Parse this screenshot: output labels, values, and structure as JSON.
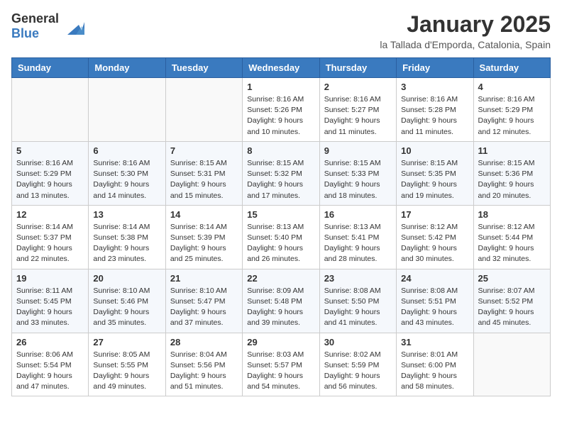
{
  "header": {
    "logo_general": "General",
    "logo_blue": "Blue",
    "month_title": "January 2025",
    "location": "la Tallada d'Emporda, Catalonia, Spain"
  },
  "weekdays": [
    "Sunday",
    "Monday",
    "Tuesday",
    "Wednesday",
    "Thursday",
    "Friday",
    "Saturday"
  ],
  "weeks": [
    [
      {
        "day": "",
        "sunrise": "",
        "sunset": "",
        "daylight": ""
      },
      {
        "day": "",
        "sunrise": "",
        "sunset": "",
        "daylight": ""
      },
      {
        "day": "",
        "sunrise": "",
        "sunset": "",
        "daylight": ""
      },
      {
        "day": "1",
        "sunrise": "Sunrise: 8:16 AM",
        "sunset": "Sunset: 5:26 PM",
        "daylight": "Daylight: 9 hours and 10 minutes."
      },
      {
        "day": "2",
        "sunrise": "Sunrise: 8:16 AM",
        "sunset": "Sunset: 5:27 PM",
        "daylight": "Daylight: 9 hours and 11 minutes."
      },
      {
        "day": "3",
        "sunrise": "Sunrise: 8:16 AM",
        "sunset": "Sunset: 5:28 PM",
        "daylight": "Daylight: 9 hours and 11 minutes."
      },
      {
        "day": "4",
        "sunrise": "Sunrise: 8:16 AM",
        "sunset": "Sunset: 5:29 PM",
        "daylight": "Daylight: 9 hours and 12 minutes."
      }
    ],
    [
      {
        "day": "5",
        "sunrise": "Sunrise: 8:16 AM",
        "sunset": "Sunset: 5:29 PM",
        "daylight": "Daylight: 9 hours and 13 minutes."
      },
      {
        "day": "6",
        "sunrise": "Sunrise: 8:16 AM",
        "sunset": "Sunset: 5:30 PM",
        "daylight": "Daylight: 9 hours and 14 minutes."
      },
      {
        "day": "7",
        "sunrise": "Sunrise: 8:15 AM",
        "sunset": "Sunset: 5:31 PM",
        "daylight": "Daylight: 9 hours and 15 minutes."
      },
      {
        "day": "8",
        "sunrise": "Sunrise: 8:15 AM",
        "sunset": "Sunset: 5:32 PM",
        "daylight": "Daylight: 9 hours and 17 minutes."
      },
      {
        "day": "9",
        "sunrise": "Sunrise: 8:15 AM",
        "sunset": "Sunset: 5:33 PM",
        "daylight": "Daylight: 9 hours and 18 minutes."
      },
      {
        "day": "10",
        "sunrise": "Sunrise: 8:15 AM",
        "sunset": "Sunset: 5:35 PM",
        "daylight": "Daylight: 9 hours and 19 minutes."
      },
      {
        "day": "11",
        "sunrise": "Sunrise: 8:15 AM",
        "sunset": "Sunset: 5:36 PM",
        "daylight": "Daylight: 9 hours and 20 minutes."
      }
    ],
    [
      {
        "day": "12",
        "sunrise": "Sunrise: 8:14 AM",
        "sunset": "Sunset: 5:37 PM",
        "daylight": "Daylight: 9 hours and 22 minutes."
      },
      {
        "day": "13",
        "sunrise": "Sunrise: 8:14 AM",
        "sunset": "Sunset: 5:38 PM",
        "daylight": "Daylight: 9 hours and 23 minutes."
      },
      {
        "day": "14",
        "sunrise": "Sunrise: 8:14 AM",
        "sunset": "Sunset: 5:39 PM",
        "daylight": "Daylight: 9 hours and 25 minutes."
      },
      {
        "day": "15",
        "sunrise": "Sunrise: 8:13 AM",
        "sunset": "Sunset: 5:40 PM",
        "daylight": "Daylight: 9 hours and 26 minutes."
      },
      {
        "day": "16",
        "sunrise": "Sunrise: 8:13 AM",
        "sunset": "Sunset: 5:41 PM",
        "daylight": "Daylight: 9 hours and 28 minutes."
      },
      {
        "day": "17",
        "sunrise": "Sunrise: 8:12 AM",
        "sunset": "Sunset: 5:42 PM",
        "daylight": "Daylight: 9 hours and 30 minutes."
      },
      {
        "day": "18",
        "sunrise": "Sunrise: 8:12 AM",
        "sunset": "Sunset: 5:44 PM",
        "daylight": "Daylight: 9 hours and 32 minutes."
      }
    ],
    [
      {
        "day": "19",
        "sunrise": "Sunrise: 8:11 AM",
        "sunset": "Sunset: 5:45 PM",
        "daylight": "Daylight: 9 hours and 33 minutes."
      },
      {
        "day": "20",
        "sunrise": "Sunrise: 8:10 AM",
        "sunset": "Sunset: 5:46 PM",
        "daylight": "Daylight: 9 hours and 35 minutes."
      },
      {
        "day": "21",
        "sunrise": "Sunrise: 8:10 AM",
        "sunset": "Sunset: 5:47 PM",
        "daylight": "Daylight: 9 hours and 37 minutes."
      },
      {
        "day": "22",
        "sunrise": "Sunrise: 8:09 AM",
        "sunset": "Sunset: 5:48 PM",
        "daylight": "Daylight: 9 hours and 39 minutes."
      },
      {
        "day": "23",
        "sunrise": "Sunrise: 8:08 AM",
        "sunset": "Sunset: 5:50 PM",
        "daylight": "Daylight: 9 hours and 41 minutes."
      },
      {
        "day": "24",
        "sunrise": "Sunrise: 8:08 AM",
        "sunset": "Sunset: 5:51 PM",
        "daylight": "Daylight: 9 hours and 43 minutes."
      },
      {
        "day": "25",
        "sunrise": "Sunrise: 8:07 AM",
        "sunset": "Sunset: 5:52 PM",
        "daylight": "Daylight: 9 hours and 45 minutes."
      }
    ],
    [
      {
        "day": "26",
        "sunrise": "Sunrise: 8:06 AM",
        "sunset": "Sunset: 5:54 PM",
        "daylight": "Daylight: 9 hours and 47 minutes."
      },
      {
        "day": "27",
        "sunrise": "Sunrise: 8:05 AM",
        "sunset": "Sunset: 5:55 PM",
        "daylight": "Daylight: 9 hours and 49 minutes."
      },
      {
        "day": "28",
        "sunrise": "Sunrise: 8:04 AM",
        "sunset": "Sunset: 5:56 PM",
        "daylight": "Daylight: 9 hours and 51 minutes."
      },
      {
        "day": "29",
        "sunrise": "Sunrise: 8:03 AM",
        "sunset": "Sunset: 5:57 PM",
        "daylight": "Daylight: 9 hours and 54 minutes."
      },
      {
        "day": "30",
        "sunrise": "Sunrise: 8:02 AM",
        "sunset": "Sunset: 5:59 PM",
        "daylight": "Daylight: 9 hours and 56 minutes."
      },
      {
        "day": "31",
        "sunrise": "Sunrise: 8:01 AM",
        "sunset": "Sunset: 6:00 PM",
        "daylight": "Daylight: 9 hours and 58 minutes."
      },
      {
        "day": "",
        "sunrise": "",
        "sunset": "",
        "daylight": ""
      }
    ]
  ]
}
